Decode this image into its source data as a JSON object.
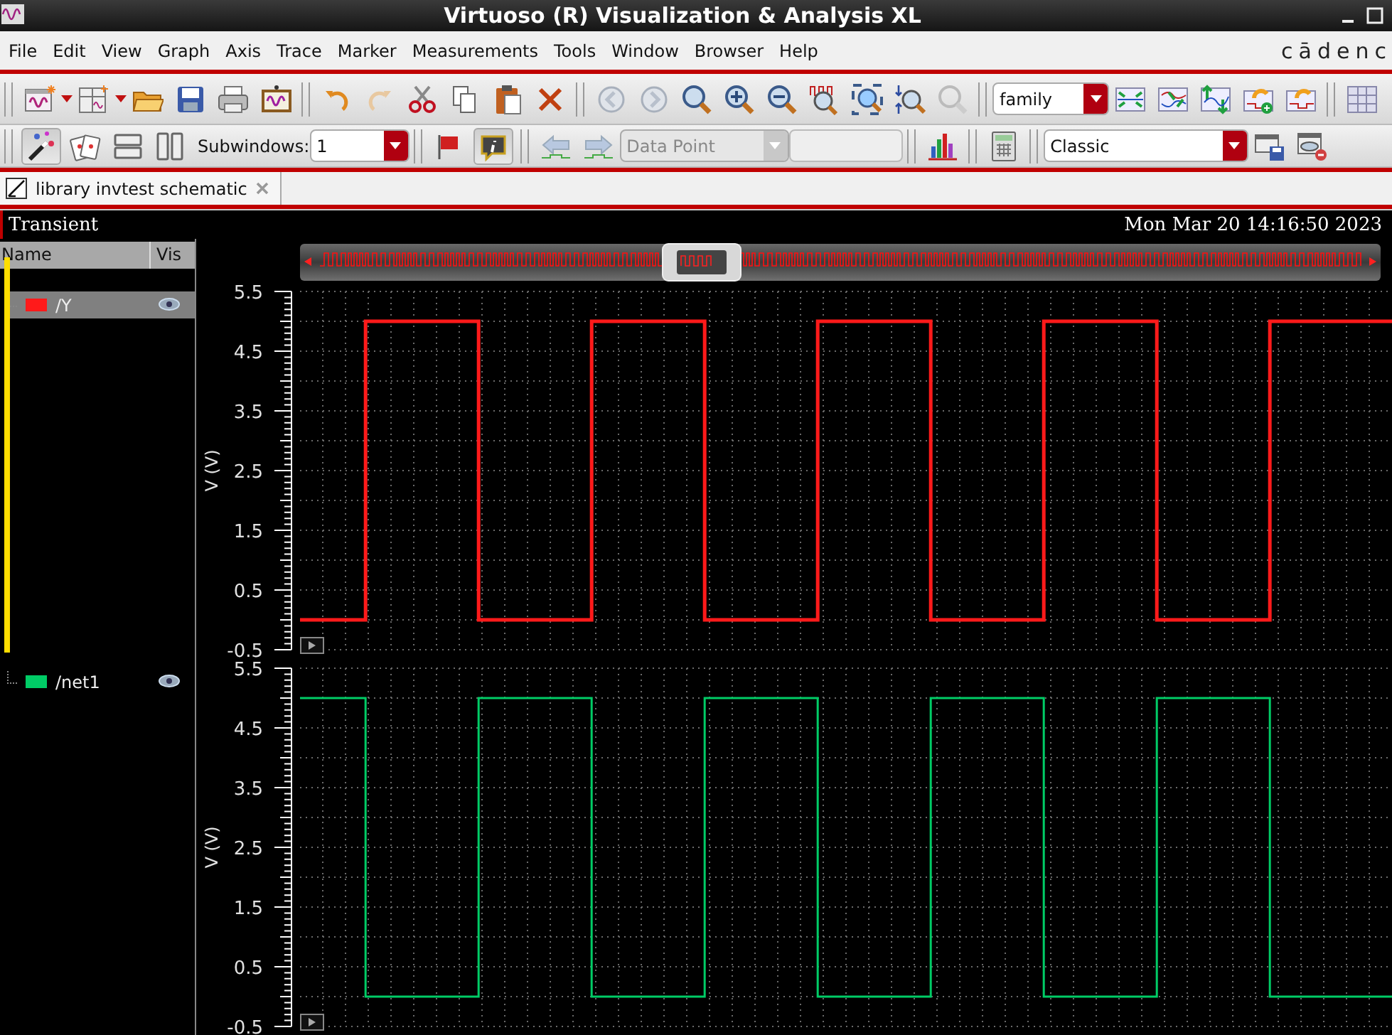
{
  "window": {
    "title": "Virtuoso (R) Visualization & Analysis XL"
  },
  "menu": [
    "File",
    "Edit",
    "View",
    "Graph",
    "Axis",
    "Trace",
    "Marker",
    "Measurements",
    "Tools",
    "Window",
    "Browser",
    "Help"
  ],
  "brand": "cādenc",
  "toolbar": {
    "family_select": {
      "value": "family"
    },
    "selection_tool": {
      "on": true
    },
    "subwindows": {
      "label": "Subwindows:",
      "value": "1"
    },
    "info_tool": {
      "on": true
    },
    "data_point": {
      "placeholder": "Data Point",
      "disabled": true
    },
    "style_select": {
      "value": "Classic"
    }
  },
  "tabs": [
    {
      "label": "library invtest schematic",
      "selected": true
    }
  ],
  "pane": {
    "title": "Transient",
    "timestamp": "Mon Mar 20 14:16:50 2023",
    "legend_columns": [
      "Name",
      "Vis"
    ]
  },
  "subwindows": [
    {
      "selected": true,
      "kind": "direct",
      "trace": {
        "name": "/Y",
        "color": "#ff1a1a",
        "selected": true,
        "visible": true
      },
      "y_axis": {
        "title": "V (V)",
        "ticks": [
          "5.5",
          "4.5",
          "3.5",
          "2.5",
          "1.5",
          "0.5",
          "-0.5"
        ]
      }
    },
    {
      "selected": false,
      "kind": "inverted",
      "trace": {
        "name": "/net1",
        "color": "#00cc66",
        "selected": false,
        "visible": true
      },
      "y_axis": {
        "title": "V (V)",
        "ticks": [
          "5.5",
          "4.5",
          "3.5",
          "2.5",
          "1.5",
          "0.5",
          "-0.5"
        ]
      }
    }
  ]
}
